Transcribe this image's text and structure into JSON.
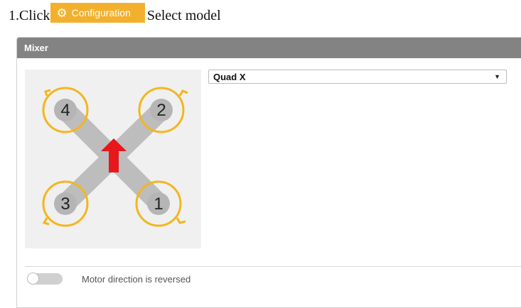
{
  "instruction": {
    "prefix": "1.Click",
    "button_label": "Configuration",
    "button_icon": "gear-icon",
    "suffix": "Select model",
    "button_color": "#f3b02d"
  },
  "mixer": {
    "title": "Mixer",
    "model_select": {
      "value": "Quad X"
    },
    "diagram": {
      "motors": [
        "4",
        "2",
        "3",
        "1"
      ],
      "arm_color": "#bdbdbd",
      "ring_color": "#f4b51f",
      "arrow_color": "#e8171b"
    },
    "reverse_toggle": {
      "label": "Motor direction is reversed",
      "on": false
    }
  }
}
